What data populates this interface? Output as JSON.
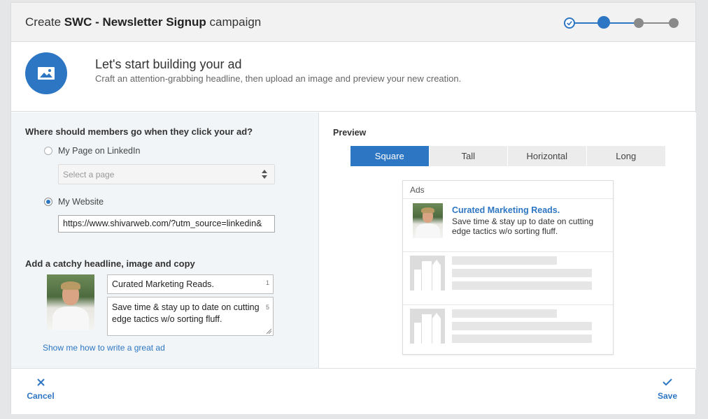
{
  "header": {
    "title_prefix": "Create ",
    "campaign_name": "SWC - Newsletter Signup",
    "title_suffix": " campaign",
    "stepper": {
      "total_steps": 4,
      "current_step": 2,
      "completed_steps": 1
    }
  },
  "intro": {
    "icon": "image-icon",
    "title": "Let's start building your ad",
    "subtitle": "Craft an attention-grabbing headline, then upload an image and preview your new creation."
  },
  "destination": {
    "question": "Where should members go when they click your ad?",
    "option_page_label": "My Page on LinkedIn",
    "option_page_selected": false,
    "select_placeholder": "Select a page",
    "option_website_label": "My Website",
    "option_website_selected": true,
    "website_url": "https://www.shivarweb.com/?utm_source=linkedin&"
  },
  "creative": {
    "section_label": "Add a catchy headline, image and copy",
    "headline": "Curated Marketing Reads.",
    "headline_counter": "1",
    "copy": "Save time & stay up to date on cutting edge tactics w/o sorting fluff.",
    "copy_counter": "5",
    "help_link": "Show me how to write a great ad"
  },
  "preview": {
    "label": "Preview",
    "tabs": [
      "Square",
      "Tall",
      "Horizontal",
      "Long"
    ],
    "active_tab": "Square",
    "card_header": "Ads",
    "ad_headline": "Curated Marketing Reads.",
    "ad_copy": "Save time & stay up to date on cutting edge tactics w/o sorting fluff."
  },
  "footer": {
    "cancel_label": "Cancel",
    "save_label": "Save"
  },
  "colors": {
    "accent": "#2d76c3",
    "inactive_step": "#8a8a8a",
    "panel_bg": "#f2f5f7"
  }
}
